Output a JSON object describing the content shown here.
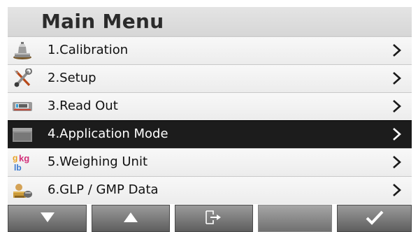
{
  "header": {
    "title": "Main Menu"
  },
  "menu": {
    "items": [
      {
        "label": "1.Calibration",
        "icon": "calibration-weight-icon",
        "selected": false
      },
      {
        "label": "2.Setup",
        "icon": "setup-tools-icon",
        "selected": false
      },
      {
        "label": "3.Read Out",
        "icon": "readout-display-icon",
        "selected": false
      },
      {
        "label": "4.Application Mode",
        "icon": "application-mode-icon",
        "selected": true
      },
      {
        "label": "5.Weighing Unit",
        "icon": "weighing-unit-icon",
        "selected": false
      },
      {
        "label": "6.GLP / GMP Data",
        "icon": "glp-gmp-data-icon",
        "selected": false
      }
    ]
  },
  "unit_icon_text": {
    "g": "g",
    "kg": "kg",
    "lb": "lb"
  },
  "softkeys": [
    {
      "icon": "arrow-down-icon"
    },
    {
      "icon": "arrow-up-icon"
    },
    {
      "icon": "exit-icon"
    },
    {
      "icon": ""
    },
    {
      "icon": "checkmark-icon"
    }
  ],
  "colors": {
    "selected_row": "#1c1c1c",
    "softkey_gradient_top": "#9b9b9b",
    "softkey_gradient_bottom": "#5e5e5e"
  }
}
